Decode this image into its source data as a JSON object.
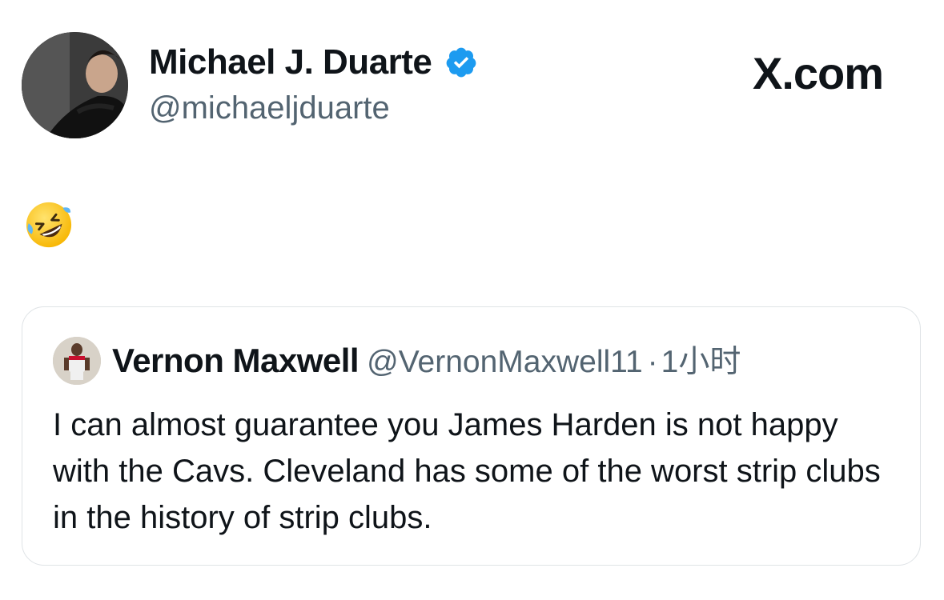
{
  "post": {
    "author": {
      "display_name": "Michael J. Duarte",
      "handle": "@michaeljduarte",
      "verified": true
    },
    "brand": "X.com",
    "body_emoji": "rolling-on-the-floor-laughing-emoji"
  },
  "quoted_post": {
    "display_name": "Vernon Maxwell",
    "handle": "@VernonMaxwell11",
    "separator": "·",
    "time": "1小时",
    "text": "I can almost guarantee you James Harden is not happy with the Cavs. Cleveland has some of the worst strip clubs in the history of strip clubs."
  },
  "colors": {
    "verified_badge": "#1d9bf0",
    "secondary_text": "#536471",
    "border": "#dfe3e6"
  }
}
